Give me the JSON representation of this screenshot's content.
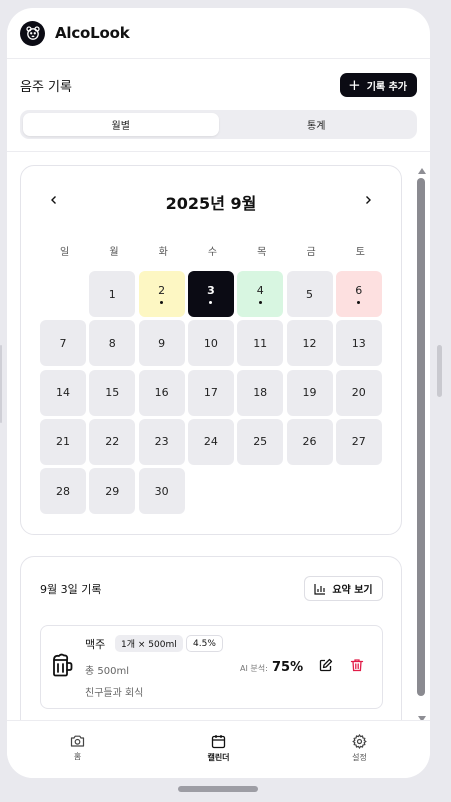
{
  "app": {
    "title": "AlcoLook"
  },
  "section": {
    "title": "음주 기록",
    "add_button": "기록 추가"
  },
  "view_tabs": [
    {
      "label": "월별",
      "active": true
    },
    {
      "label": "통계",
      "active": false
    }
  ],
  "calendar": {
    "month_title": "2025년 9월",
    "prev_icon": "chevron-left-icon",
    "next_icon": "chevron-right-icon",
    "weekdays": [
      "일",
      "월",
      "화",
      "수",
      "목",
      "금",
      "토"
    ],
    "days": [
      {
        "n": "1",
        "col": 1,
        "row": 0,
        "bg": "#ebebef",
        "dot": false
      },
      {
        "n": "2",
        "col": 2,
        "row": 0,
        "bg": "#fdf7c3",
        "dot": true
      },
      {
        "n": "3",
        "col": 3,
        "row": 0,
        "bg": "#0b0b14",
        "dot": true,
        "selected": true
      },
      {
        "n": "4",
        "col": 4,
        "row": 0,
        "bg": "#d8f6e1",
        "dot": true
      },
      {
        "n": "5",
        "col": 5,
        "row": 0,
        "bg": "#ebebef",
        "dot": false
      },
      {
        "n": "6",
        "col": 6,
        "row": 0,
        "bg": "#fde0e0",
        "dot": true
      },
      {
        "n": "7",
        "col": 0,
        "row": 1,
        "bg": "#ebebef",
        "dot": false
      },
      {
        "n": "8",
        "col": 1,
        "row": 1,
        "bg": "#ebebef",
        "dot": false
      },
      {
        "n": "9",
        "col": 2,
        "row": 1,
        "bg": "#ebebef",
        "dot": false
      },
      {
        "n": "10",
        "col": 3,
        "row": 1,
        "bg": "#ebebef",
        "dot": false
      },
      {
        "n": "11",
        "col": 4,
        "row": 1,
        "bg": "#ebebef",
        "dot": false
      },
      {
        "n": "12",
        "col": 5,
        "row": 1,
        "bg": "#ebebef",
        "dot": false
      },
      {
        "n": "13",
        "col": 6,
        "row": 1,
        "bg": "#ebebef",
        "dot": false
      },
      {
        "n": "14",
        "col": 0,
        "row": 2,
        "bg": "#ebebef",
        "dot": false
      },
      {
        "n": "15",
        "col": 1,
        "row": 2,
        "bg": "#ebebef",
        "dot": false
      },
      {
        "n": "16",
        "col": 2,
        "row": 2,
        "bg": "#ebebef",
        "dot": false
      },
      {
        "n": "17",
        "col": 3,
        "row": 2,
        "bg": "#ebebef",
        "dot": false
      },
      {
        "n": "18",
        "col": 4,
        "row": 2,
        "bg": "#ebebef",
        "dot": false
      },
      {
        "n": "19",
        "col": 5,
        "row": 2,
        "bg": "#ebebef",
        "dot": false
      },
      {
        "n": "20",
        "col": 6,
        "row": 2,
        "bg": "#ebebef",
        "dot": false
      },
      {
        "n": "21",
        "col": 0,
        "row": 3,
        "bg": "#ebebef",
        "dot": false
      },
      {
        "n": "22",
        "col": 1,
        "row": 3,
        "bg": "#ebebef",
        "dot": false
      },
      {
        "n": "23",
        "col": 2,
        "row": 3,
        "bg": "#ebebef",
        "dot": false
      },
      {
        "n": "24",
        "col": 3,
        "row": 3,
        "bg": "#ebebef",
        "dot": false
      },
      {
        "n": "25",
        "col": 4,
        "row": 3,
        "bg": "#ebebef",
        "dot": false
      },
      {
        "n": "26",
        "col": 5,
        "row": 3,
        "bg": "#ebebef",
        "dot": false
      },
      {
        "n": "27",
        "col": 6,
        "row": 3,
        "bg": "#ebebef",
        "dot": false
      },
      {
        "n": "28",
        "col": 0,
        "row": 4,
        "bg": "#ebebef",
        "dot": false
      },
      {
        "n": "29",
        "col": 1,
        "row": 4,
        "bg": "#ebebef",
        "dot": false
      },
      {
        "n": "30",
        "col": 2,
        "row": 4,
        "bg": "#ebebef",
        "dot": false
      }
    ]
  },
  "records": {
    "title": "9월 3일 기록",
    "summary_button": "요약 보기",
    "entry": {
      "icon": "beer-mug-icon",
      "name": "맥주",
      "quantity": "1개 × 500ml",
      "abv": "4.5%",
      "total": "총 500ml",
      "note": "친구들과 회식",
      "ai_label": "AI 분석:",
      "ai_value": "75%"
    }
  },
  "bottom_nav": [
    {
      "label": "홈",
      "icon": "camera-icon",
      "active": false
    },
    {
      "label": "캘린더",
      "icon": "calendar-icon",
      "active": true
    },
    {
      "label": "설정",
      "icon": "gear-icon",
      "active": false
    }
  ],
  "colors": {
    "accent": "#0b0b14",
    "delete": "#e11d48",
    "day_default": "#ebebef"
  }
}
